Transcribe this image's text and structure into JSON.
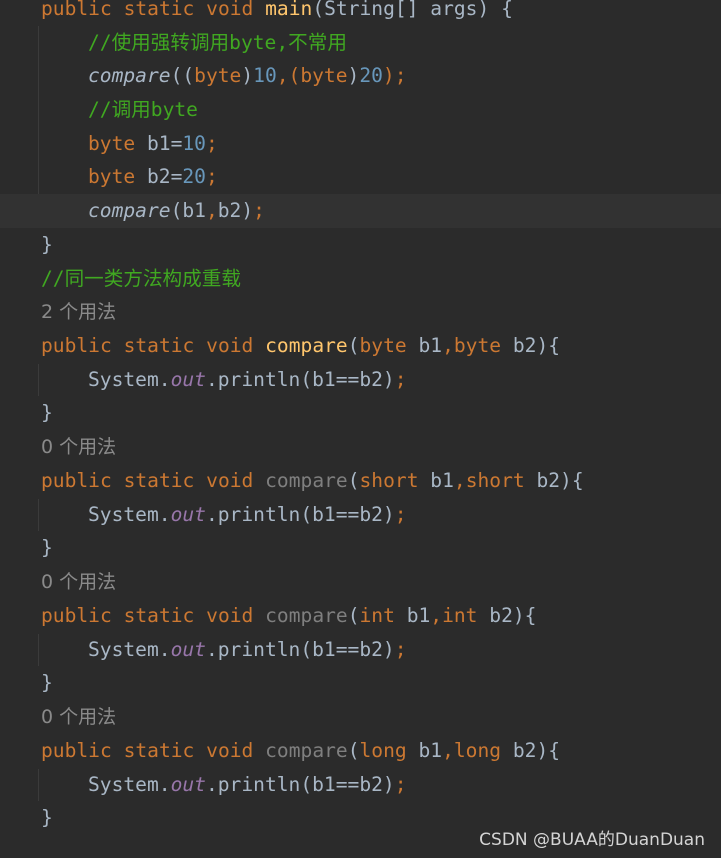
{
  "colors": {
    "background": "#2b2b2b",
    "current_line": "#323232",
    "keyword": "#cc7832",
    "method_declaration": "#ffc66d",
    "unused_method": "#7f7f7f",
    "number": "#6897bb",
    "comment": "#40a821",
    "static_field": "#9876aa",
    "plain": "#a9b7c6",
    "usage_hint": "#8a8a8a"
  },
  "code": {
    "main_decl": {
      "kw": "public static void",
      "name": "main",
      "params": "(String[] args) {"
    },
    "comment_cast": "//使用强转调用byte,不常用",
    "call_cast": {
      "name": "compare",
      "open": "((",
      "type1": "byte",
      "close1": ")",
      "val1": "10",
      "comma": ",(",
      "type2": "byte",
      "close2": ")",
      "val2": "20",
      "end": ");"
    },
    "comment_byte": "//调用byte",
    "decl_b1": {
      "type": "byte",
      "rest": " b1=",
      "val": "10",
      "end": ";"
    },
    "decl_b2": {
      "type": "byte",
      "rest": " b2=",
      "val": "20",
      "end": ";"
    },
    "call_vars": {
      "name": "compare",
      "args": "(b1",
      "comma": ",",
      "args2": "b2)",
      "end": ";"
    },
    "close_main": "}",
    "comment_overload": "//同一类方法构成重载",
    "methods": [
      {
        "usages": "2 个用法",
        "kw": "public static void",
        "name": "compare",
        "open": "(",
        "t1": "byte",
        "p1": " b1",
        "comma": ",",
        "t2": "byte",
        "p2": " b2){",
        "sys": "System.",
        "out": "out",
        "println": ".println(b1==b2)",
        "semi": ";",
        "close": "}"
      },
      {
        "usages": "0 个用法",
        "kw": "public static void",
        "name": "compare",
        "open": "(",
        "t1": "short",
        "p1": " b1",
        "comma": ",",
        "t2": "short",
        "p2": " b2){",
        "sys": "System.",
        "out": "out",
        "println": ".println(b1==b2)",
        "semi": ";",
        "close": "}"
      },
      {
        "usages": "0 个用法",
        "kw": "public static void",
        "name": "compare",
        "open": "(",
        "t1": "int",
        "p1": " b1",
        "comma": ",",
        "t2": "int",
        "p2": " b2){",
        "sys": "System.",
        "out": "out",
        "println": ".println(b1==b2)",
        "semi": ";",
        "close": "}"
      },
      {
        "usages": "0 个用法",
        "kw": "public static void",
        "name": "compare",
        "open": "(",
        "t1": "long",
        "p1": " b1",
        "comma": ",",
        "t2": "long",
        "p2": " b2){",
        "sys": "System.",
        "out": "out",
        "println": ".println(b1==b2)",
        "semi": ";",
        "close": "}"
      }
    ]
  },
  "watermark": "CSDN @BUAA的DuanDuan"
}
